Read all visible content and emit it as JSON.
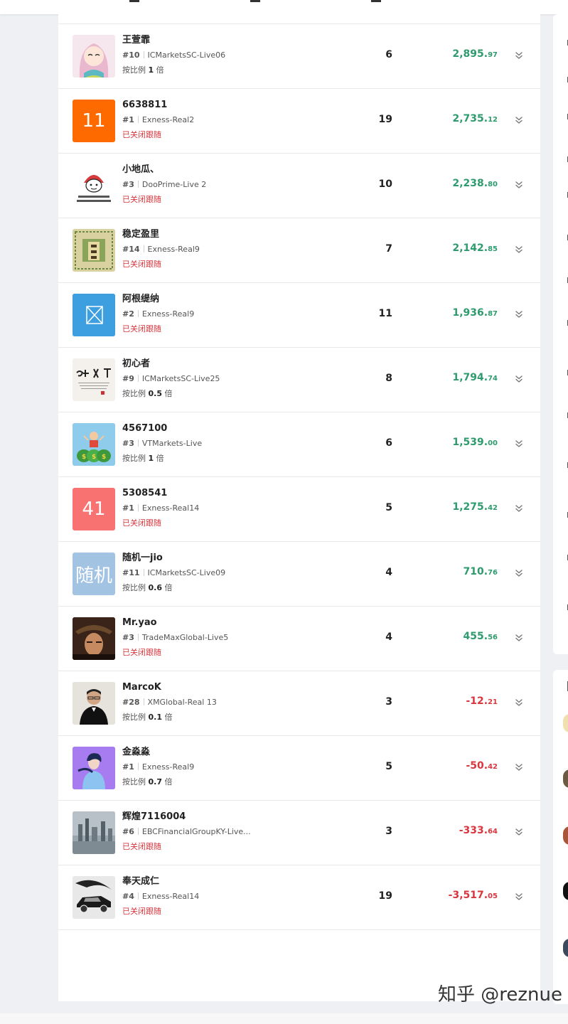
{
  "colors": {
    "positive": "#2e9b6e",
    "negative": "#d9363e",
    "closed_status": "#d9363e"
  },
  "rows": [
    {
      "name": "王萱霏",
      "rank": "#10",
      "account": "ICMarketsSC-Live06",
      "status_type": "ratio",
      "status_prefix": "按比例",
      "ratio": "1",
      "status_suffix": "倍",
      "count": "6",
      "profit_int": "2,895.",
      "profit_dec": "97",
      "profit_sign": "pos",
      "avatar": {
        "kind": "anime-girl-avatar",
        "bg": "#f6e7ee"
      }
    },
    {
      "name": "6638811",
      "rank": "#1",
      "account": "Exness-Real2",
      "status_type": "closed",
      "status_text": "已关闭跟随",
      "count": "19",
      "profit_int": "2,735.",
      "profit_dec": "12",
      "profit_sign": "pos",
      "avatar": {
        "kind": "text-avatar",
        "text": "11",
        "bg": "#ff6a00"
      }
    },
    {
      "name": "小地瓜、",
      "rank": "#3",
      "account": "DooPrime-Live 2",
      "status_type": "closed",
      "status_text": "已关闭跟随",
      "count": "10",
      "profit_int": "2,238.",
      "profit_dec": "80",
      "profit_sign": "pos",
      "avatar": {
        "kind": "cartoon-meme-avatar",
        "bg": "#ffffff"
      }
    },
    {
      "name": "稳定盈里",
      "rank": "#14",
      "account": "Exness-Real9",
      "status_type": "closed",
      "status_text": "已关闭跟随",
      "count": "7",
      "profit_int": "2,142.",
      "profit_dec": "85",
      "profit_sign": "pos",
      "avatar": {
        "kind": "pattern-avatar",
        "bg": "#d9d2a0"
      }
    },
    {
      "name": "阿根缇纳",
      "rank": "#2",
      "account": "Exness-Real9",
      "status_type": "closed",
      "status_text": "已关闭跟随",
      "count": "11",
      "profit_int": "1,936.",
      "profit_dec": "87",
      "profit_sign": "pos",
      "avatar": {
        "kind": "broken-image-avatar",
        "bg": "#3d9fe0"
      }
    },
    {
      "name": "初心者",
      "rank": "#9",
      "account": "ICMarketsSC-Live25",
      "status_type": "ratio",
      "status_prefix": "按比例",
      "ratio": "0.5",
      "status_suffix": "倍",
      "count": "8",
      "profit_int": "1,794.",
      "profit_dec": "74",
      "profit_sign": "pos",
      "avatar": {
        "kind": "calligraphy-avatar",
        "bg": "#f4f1ec"
      }
    },
    {
      "name": "4567100",
      "rank": "#3",
      "account": "VTMarkets-Live",
      "status_type": "ratio",
      "status_prefix": "按比例",
      "ratio": "1",
      "status_suffix": "倍",
      "count": "6",
      "profit_int": "1,539.",
      "profit_dec": "00",
      "profit_sign": "pos",
      "avatar": {
        "kind": "money-bag-avatar",
        "bg": "#8fcbea"
      }
    },
    {
      "name": "5308541",
      "rank": "#1",
      "account": "Exness-Real14",
      "status_type": "closed",
      "status_text": "已关闭跟随",
      "count": "5",
      "profit_int": "1,275.",
      "profit_dec": "42",
      "profit_sign": "pos",
      "avatar": {
        "kind": "text-avatar",
        "text": "41",
        "bg": "#f87272"
      }
    },
    {
      "name": "随机一jio",
      "rank": "#11",
      "account": "ICMarketsSC-Live09",
      "status_type": "ratio",
      "status_prefix": "按比例",
      "ratio": "0.6",
      "status_suffix": "倍",
      "count": "4",
      "profit_int": "710.",
      "profit_dec": "76",
      "profit_sign": "pos",
      "avatar": {
        "kind": "text-avatar",
        "text": "随机",
        "bg": "#a3c3e3"
      }
    },
    {
      "name": "Mr.yao",
      "rank": "#3",
      "account": "TradeMaxGlobal-Live5",
      "status_type": "closed",
      "status_text": "已关闭跟随",
      "count": "4",
      "profit_int": "455.",
      "profit_dec": "56",
      "profit_sign": "pos",
      "avatar": {
        "kind": "movie-still-avatar",
        "bg": "#3a2318"
      }
    },
    {
      "name": "MarcoK",
      "rank": "#28",
      "account": "XMGlobal-Real 13",
      "status_type": "ratio",
      "status_prefix": "按比例",
      "ratio": "0.1",
      "status_suffix": "倍",
      "count": "3",
      "profit_int": "-12.",
      "profit_dec": "21",
      "profit_sign": "neg",
      "avatar": {
        "kind": "man-portrait-avatar",
        "bg": "#e6e2dc"
      }
    },
    {
      "name": "金淼淼",
      "rank": "#1",
      "account": "Exness-Real9",
      "status_type": "ratio",
      "status_prefix": "按比例",
      "ratio": "0.7",
      "status_suffix": "倍",
      "count": "5",
      "profit_int": "-50.",
      "profit_dec": "42",
      "profit_sign": "neg",
      "avatar": {
        "kind": "illustration-avatar",
        "bg": "#a77cf0"
      }
    },
    {
      "name": "辉煌7116004",
      "rank": "#6",
      "account": "EBCFinancialGroupKY-Live...",
      "status_type": "closed",
      "status_text": "已关闭跟随",
      "count": "3",
      "profit_int": "-333.",
      "profit_dec": "64",
      "profit_sign": "neg",
      "avatar": {
        "kind": "city-skyline-avatar",
        "bg": "#9aa6ae"
      }
    },
    {
      "name": "奉天成仁",
      "rank": "#4",
      "account": "Exness-Real14",
      "status_type": "closed",
      "status_text": "已关闭跟随",
      "count": "19",
      "profit_int": "-3,517.",
      "profit_dec": "05",
      "profit_sign": "neg",
      "avatar": {
        "kind": "car-sketch-avatar",
        "bg": "#e8e8e8"
      }
    }
  ],
  "watermark": "知乎 @reznue"
}
